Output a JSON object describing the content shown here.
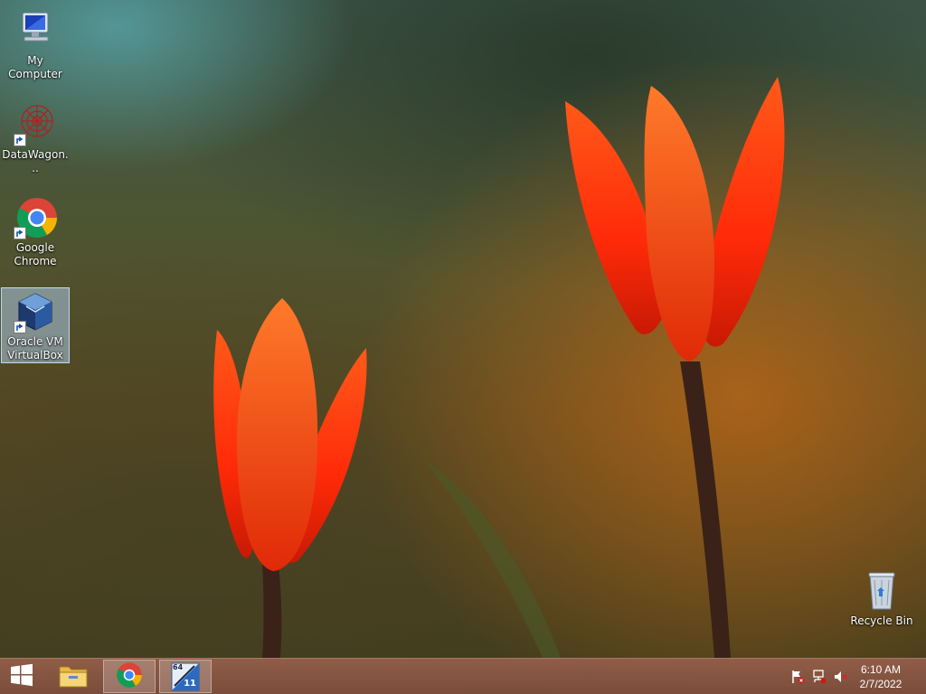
{
  "desktop": {
    "icons": [
      {
        "label": "My Computer"
      },
      {
        "label": "DataWagon..."
      },
      {
        "label": "Google Chrome"
      },
      {
        "label": "Oracle VM VirtualBox"
      },
      {
        "label": "Recycle Bin"
      }
    ]
  },
  "taskbar": {
    "start_icon": "windows-logo-icon",
    "pinned": [
      {
        "name": "file-explorer-icon"
      },
      {
        "name": "chrome-icon"
      },
      {
        "name": "app-64-11-icon",
        "badge_top": "64",
        "badge_bottom": "11"
      }
    ],
    "tray": [
      "action-center-flag-icon",
      "network-icon",
      "volume-muted-icon"
    ],
    "clock": {
      "time": "6:10 AM",
      "date": "2/7/2022"
    }
  },
  "colors": {
    "taskbar": "#8c5a46",
    "tulip": "#ff3a10",
    "selection": "#aac8e6"
  }
}
